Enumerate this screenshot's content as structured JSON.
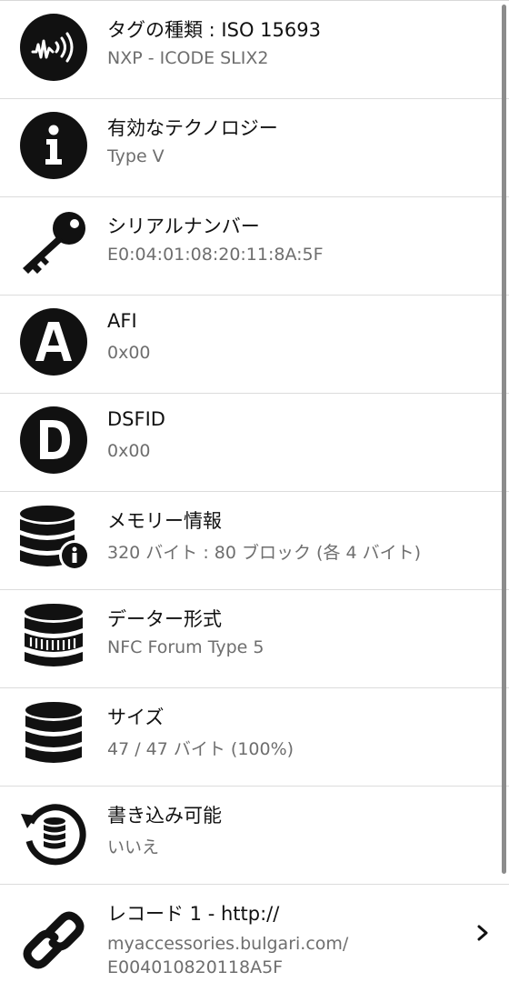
{
  "rows": [
    {
      "icon": "nfc-sound-icon",
      "title": "タグの種類 : ISO 15693",
      "subtitle": "NXP - ICODE SLIX2"
    },
    {
      "icon": "info-icon",
      "title": "有効なテクノロジー",
      "subtitle": "Type V"
    },
    {
      "icon": "key-icon",
      "title": "シリアルナンバー",
      "subtitle": "E0:04:01:08:20:11:8A:5F"
    },
    {
      "icon": "letter-a-icon",
      "title": "AFI",
      "subtitle": "0x00"
    },
    {
      "icon": "letter-d-icon",
      "title": "DSFID",
      "subtitle": "0x00"
    },
    {
      "icon": "database-info-icon",
      "title": "メモリー情報",
      "subtitle": "320 バイト : 80 ブロック (各 4 バイト)"
    },
    {
      "icon": "database-format-icon",
      "title": "データー形式",
      "subtitle": "NFC Forum Type 5"
    },
    {
      "icon": "database-icon",
      "title": "サイズ",
      "subtitle": "47 / 47 バイト (100%)"
    },
    {
      "icon": "database-history-icon",
      "title": "書き込み可能",
      "subtitle": "いいえ"
    },
    {
      "icon": "link-icon",
      "title": "レコード 1 - http://",
      "subtitle": "myaccessories.bulgari.com/ E004010820118A5F"
    }
  ],
  "colors": {
    "icon": "#111111",
    "title": "#111111",
    "subtitle": "#6e6e6e",
    "divider": "#dcdcdc"
  }
}
